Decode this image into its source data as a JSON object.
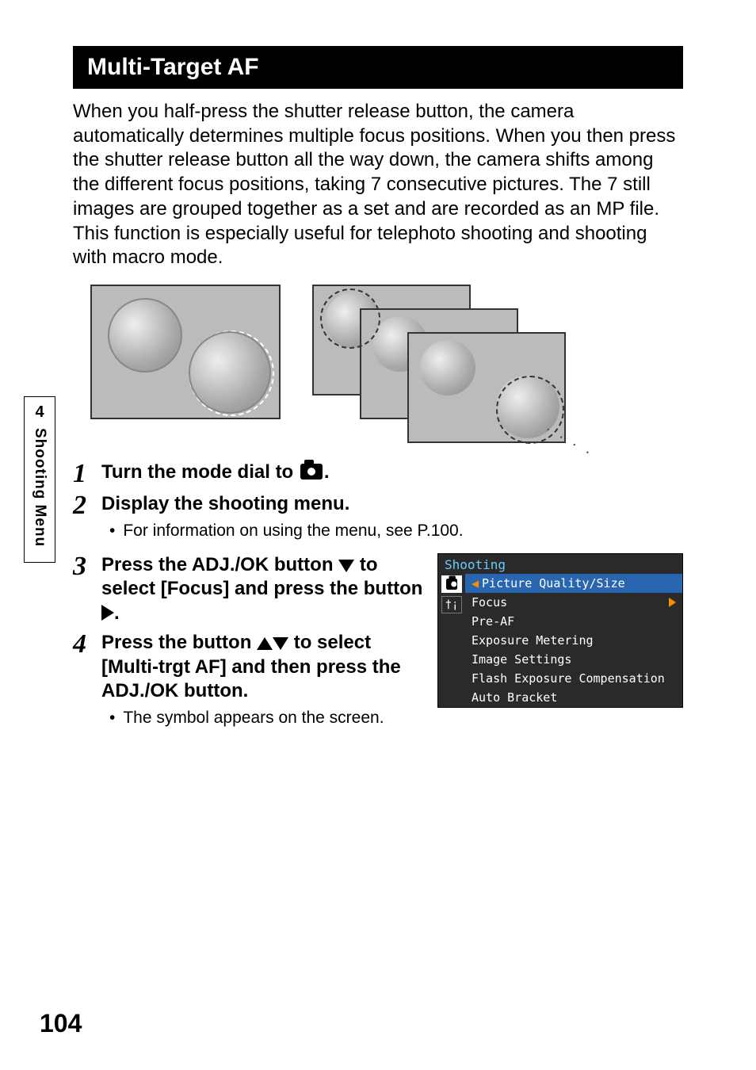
{
  "side": {
    "chapter": "4",
    "label": "Shooting Menu"
  },
  "header": "Multi-Target AF",
  "intro": "When you half-press the shutter release button, the camera automatically determines multiple focus positions. When you then press the shutter release button all the way down, the camera shifts among the different focus positions, taking 7 consecutive pictures. The 7 still images are grouped together as a set and are recorded as an MP file.\nThis function is especially useful for telephoto shooting and shooting with macro mode.",
  "steps": {
    "s1": {
      "num": "1",
      "title_a": "Turn the mode dial to ",
      "title_b": "."
    },
    "s2": {
      "num": "2",
      "title": "Display the shooting menu.",
      "bullet": "For information on using the menu, see P.100."
    },
    "s3": {
      "num": "3",
      "title_a": "Press the ADJ./OK button ",
      "title_b": " to select [Focus] and press the button ",
      "title_c": "."
    },
    "s4": {
      "num": "4",
      "title_a": "Press the button ",
      "title_b": " to select [Multi-trgt AF] and then press the ADJ./OK button.",
      "bullet": "The symbol appears on the screen."
    }
  },
  "menu": {
    "title": "Shooting",
    "items": [
      {
        "label": "Picture Quality/Size",
        "selected": true
      },
      {
        "label": "Focus",
        "selected": false,
        "arrow": true
      },
      {
        "label": "Pre-AF",
        "selected": false
      },
      {
        "label": "Exposure Metering",
        "selected": false
      },
      {
        "label": "Image Settings",
        "selected": false
      },
      {
        "label": "Flash Exposure Compensation",
        "selected": false
      },
      {
        "label": "Auto Bracket",
        "selected": false
      }
    ],
    "tab_icons": {
      "cam": "◉",
      "tools": "†¡"
    }
  },
  "page_number": "104"
}
